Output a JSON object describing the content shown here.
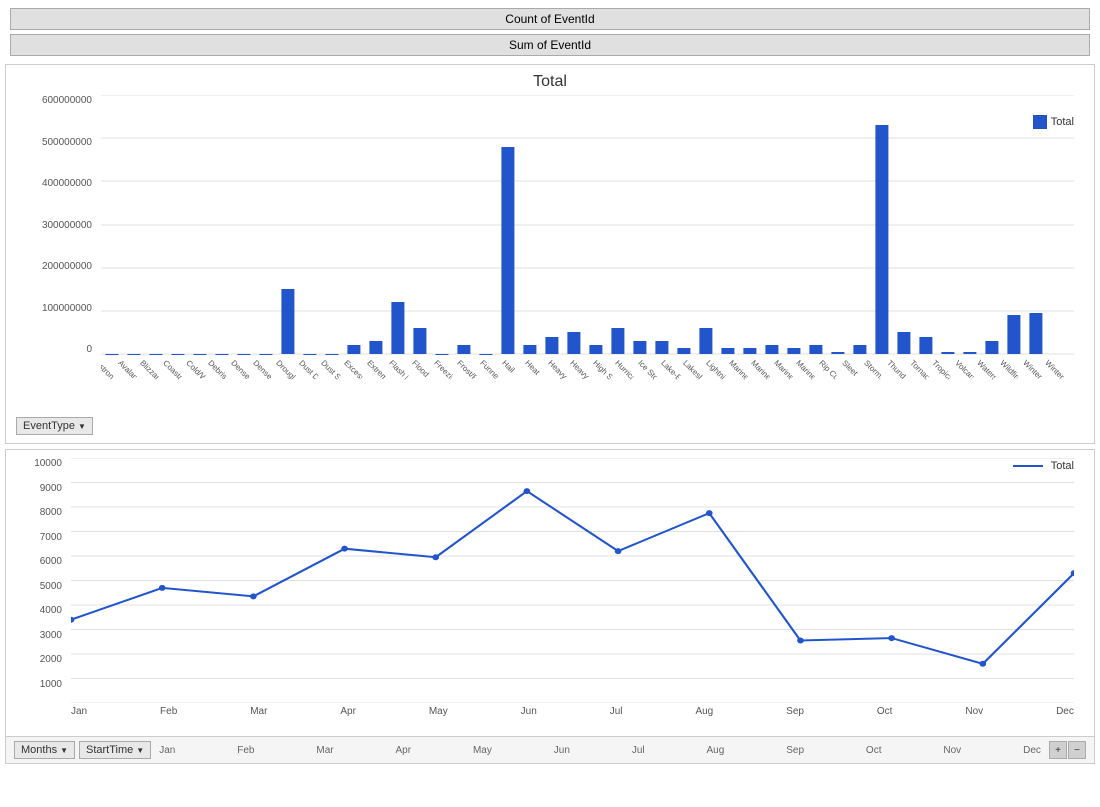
{
  "buttons": {
    "count_label": "Count of EventId",
    "sum_label": "Sum of EventId"
  },
  "bar_chart": {
    "title": "Total",
    "legend_label": "Total",
    "y_axis": [
      "600000000",
      "500000000",
      "400000000",
      "300000000",
      "200000000",
      "100000000",
      "0"
    ],
    "categories": [
      "Astronomical...",
      "Avalanche",
      "Blizzard",
      "Coastal Flood",
      "Cold/Wind Chill",
      "Debris Flow",
      "Dense Fog",
      "Dense Smoke",
      "Drought",
      "Dust Devil",
      "Dust Storm",
      "Excessive Heat",
      "Extreme...",
      "Flash Flood",
      "Flood",
      "Freezing Fog",
      "Frost/Freeze",
      "Funnel Cloud",
      "Hail",
      "Heat",
      "Heavy Rain",
      "Heavy Snow",
      "High Surf",
      "Hurricane...",
      "Ice Storm",
      "Lake-Effect...",
      "Lakeshore...",
      "Lightning",
      "Marine Hail",
      "Marine High...",
      "Marine Strong...",
      "Marine...",
      "Rip Current",
      "Sleet",
      "Storm...",
      "Thunderstorm...",
      "Tornado",
      "Tropical...",
      "Volcanic Ash",
      "Waterspout",
      "Wildfire",
      "Winter Storm",
      "Winter..."
    ],
    "values": [
      2,
      1,
      1,
      3,
      4,
      2,
      2,
      2,
      150000000,
      2,
      2,
      20000000,
      30000000,
      120000000,
      60000000,
      2,
      20000000,
      2,
      480000000,
      20000000,
      40000000,
      50000000,
      20000000,
      60000000,
      30000000,
      30000000,
      15000000,
      60000000,
      15000000,
      15000000,
      20000000,
      15000000,
      20000000,
      5000000,
      20000000,
      530000000,
      50000000,
      40000000,
      5000000,
      5000000,
      30000000,
      90000000,
      95000000
    ],
    "x_field_label": "EventType"
  },
  "line_chart": {
    "legend_label": "Total",
    "y_axis": [
      "10000",
      "9000",
      "8000",
      "7000",
      "6000",
      "5000",
      "4000",
      "3000",
      "2000",
      "1000",
      ""
    ],
    "months": [
      "Jan",
      "Feb",
      "Mar",
      "Apr",
      "May",
      "Jun",
      "Jul",
      "Aug",
      "Sep",
      "Oct",
      "Nov",
      "Dec"
    ],
    "values": [
      3400,
      4700,
      4350,
      6300,
      5950,
      8650,
      6200,
      7750,
      2550,
      2650,
      1600,
      5300
    ],
    "x_field_label": "StartTime",
    "x_group_label": "Months"
  },
  "bottom_controls": {
    "months_label": "Months",
    "starttime_label": "StartTime"
  }
}
